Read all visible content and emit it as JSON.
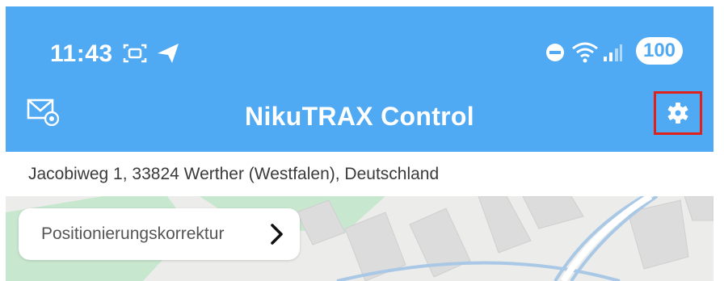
{
  "status_bar": {
    "time": "11:43",
    "battery": "100",
    "icons": [
      "screen-record-icon",
      "send-icon",
      "do-not-disturb-icon",
      "wifi-icon",
      "signal-icon"
    ]
  },
  "app_bar": {
    "title": "NikuTRAX Control",
    "left_icon": "mail-icon",
    "right_icon": "gear-icon"
  },
  "address": {
    "text": "Jacobiweg 1, 33824 Werther (Westfalen), Deutschland"
  },
  "map": {
    "correction_button_label": "Positionierungskorrektur"
  },
  "colors": {
    "header_blue": "#4FA9F3",
    "highlight_red": "#E0201B",
    "map_background": "#ECECEA",
    "map_green": "#C8E7CF",
    "building": "#DCDCDC"
  }
}
